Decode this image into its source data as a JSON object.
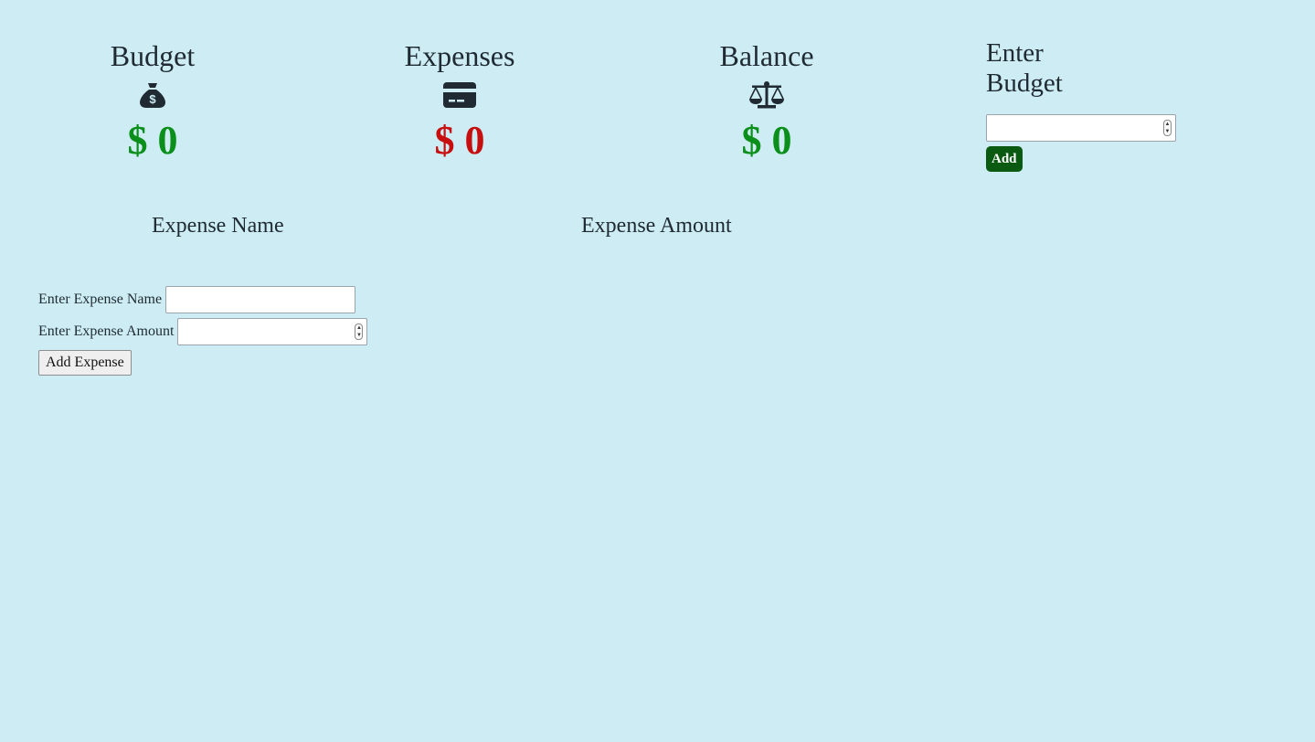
{
  "summary": {
    "budget": {
      "title": "Budget",
      "amount": "$ 0",
      "icon": "money-bag-icon"
    },
    "expenses": {
      "title": "Expenses",
      "amount": "$ 0",
      "icon": "credit-card-icon"
    },
    "balance": {
      "title": "Balance",
      "amount": "$ 0",
      "icon": "balance-scale-icon"
    }
  },
  "budget_form": {
    "title": "Enter Budget",
    "input_value": "",
    "add_label": "Add"
  },
  "expense_table": {
    "columns": [
      "Expense Name",
      "Expense Amount"
    ]
  },
  "expense_form": {
    "name_label": "Enter Expense Name",
    "name_value": "",
    "amount_label": "Enter Expense Amount",
    "amount_value": "",
    "submit_label": "Add Expense"
  },
  "colors": {
    "background": "#cdecf3",
    "positive": "#0a8f1a",
    "negative": "#c80f0f",
    "add_button": "#0b5a12"
  }
}
